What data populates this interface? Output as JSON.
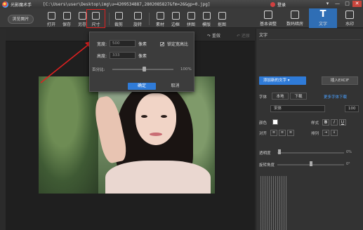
{
  "titlebar": {
    "app_name": "光影魔术手",
    "file_path": "[C:\\Users\\user\\Desktop\\img\\u=4209534887,2802085827&fm=26&gp=0.jpg]",
    "login": "登录",
    "controls": [
      "▾",
      "—",
      "□",
      "✕"
    ]
  },
  "toolbar": {
    "browse": "浏览图片",
    "tools": [
      "打开",
      "保存",
      "另存",
      "尺寸",
      "裁剪",
      "旋转",
      "素材",
      "边框",
      "拼图",
      "模版",
      "抠图"
    ],
    "active_tool": "尺寸"
  },
  "right_tabs": [
    {
      "label": "基本调整",
      "icon": "adjust-icon"
    },
    {
      "label": "数码暗房",
      "icon": "camera-icon"
    },
    {
      "label": "文字",
      "icon": "text-icon",
      "glyph": "T"
    },
    {
      "label": "水印",
      "icon": "watermark-icon"
    }
  ],
  "subbar": {
    "redo": "↷ 重做",
    "undo": "↶ 还原"
  },
  "dialog": {
    "width_label": "宽度:",
    "width_value": "500",
    "width_unit": "像素",
    "height_label": "高度:",
    "height_value": "333",
    "height_unit": "像素",
    "lock_label": "锁定宽高比",
    "lock_checked": true,
    "percent_label": "百分比:",
    "percent_value": "100%",
    "percent_level": 0.5,
    "ok": "确定",
    "cancel": "取消"
  },
  "text_panel": {
    "title": "文字",
    "add_text": "添加新的文字 ▾",
    "insert_exif": "插入EXCIF",
    "font_label": "字体",
    "font_local": "本地",
    "font_download": "下载",
    "more_fonts": "更多字体下载",
    "font_name": "宋体",
    "font_size": "100",
    "color_label": "颜色",
    "style_label": "样式",
    "style_buttons": [
      "B",
      "I",
      "U"
    ],
    "align_label": "对齐",
    "arrange_label": "排列",
    "opacity_label": "透明度",
    "opacity_value": "0%",
    "rotate_label": "旋转角度",
    "rotate_value": "0°"
  },
  "colors": {
    "accent": "#2f7bd8",
    "highlight": "#e02020",
    "panel": "#333333"
  }
}
